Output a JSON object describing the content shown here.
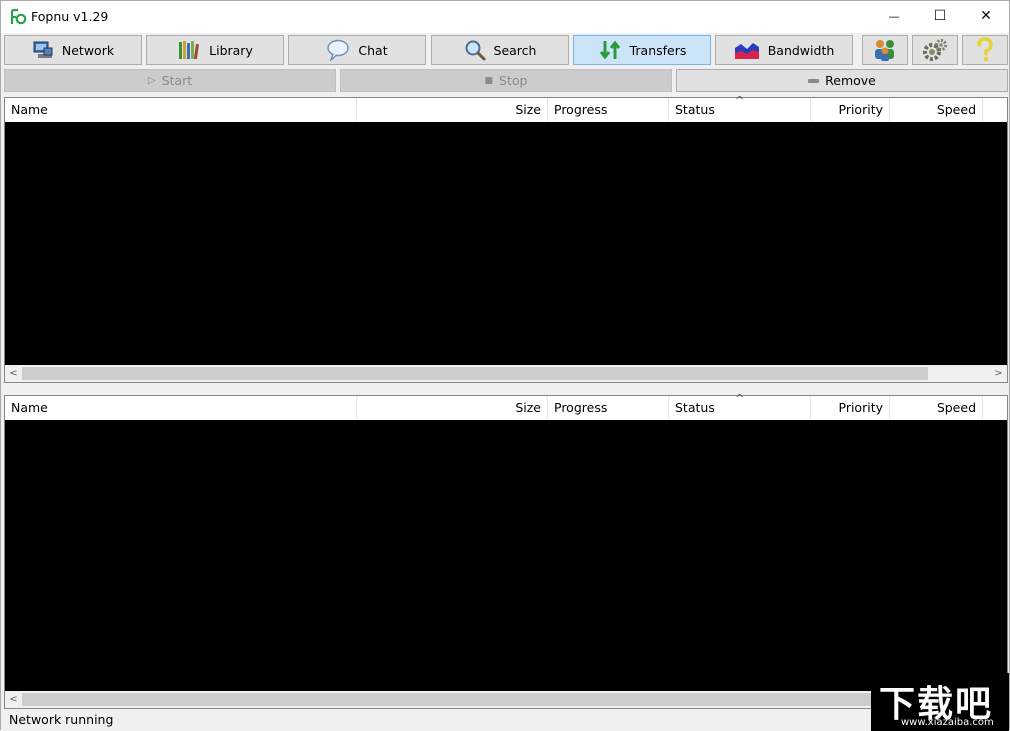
{
  "window": {
    "title": "Fopnu v1.29",
    "minimize_glyph": "—",
    "maximize_glyph": "☐",
    "close_glyph": "✕"
  },
  "nav": {
    "network": {
      "label": "Network",
      "icon": "network-computer-icon"
    },
    "library": {
      "label": "Library",
      "icon": "books-icon"
    },
    "chat": {
      "label": "Chat",
      "icon": "speech-bubble-icon"
    },
    "search": {
      "label": "Search",
      "icon": "magnifier-icon"
    },
    "transfers": {
      "label": "Transfers",
      "icon": "transfer-arrows-icon",
      "active": true
    },
    "bandwidth": {
      "label": "Bandwidth",
      "icon": "bandwidth-graph-icon"
    },
    "users": {
      "icon": "users-icon"
    },
    "settings": {
      "icon": "gears-icon"
    },
    "help": {
      "icon": "question-icon"
    }
  },
  "actions": {
    "start": {
      "label": "Start",
      "enabled": false
    },
    "stop": {
      "label": "Stop",
      "enabled": false
    },
    "remove": {
      "label": "Remove",
      "enabled": true
    }
  },
  "upper_list": {
    "columns": [
      "Name",
      "Size",
      "Progress",
      "Status",
      "Priority",
      "Speed"
    ],
    "sort_indicator": "^",
    "rows": []
  },
  "lower_list": {
    "columns": [
      "Name",
      "Size",
      "Progress",
      "Status",
      "Priority",
      "Speed"
    ],
    "sort_indicator": "^",
    "rows": []
  },
  "status": {
    "text": "Network running"
  },
  "watermark": {
    "main": "下载吧",
    "sub": "www.xiazaiba.com"
  },
  "colors": {
    "active_tab": "#cce4f7",
    "list_background": "#000000",
    "logo_green": "#2aa14a"
  }
}
